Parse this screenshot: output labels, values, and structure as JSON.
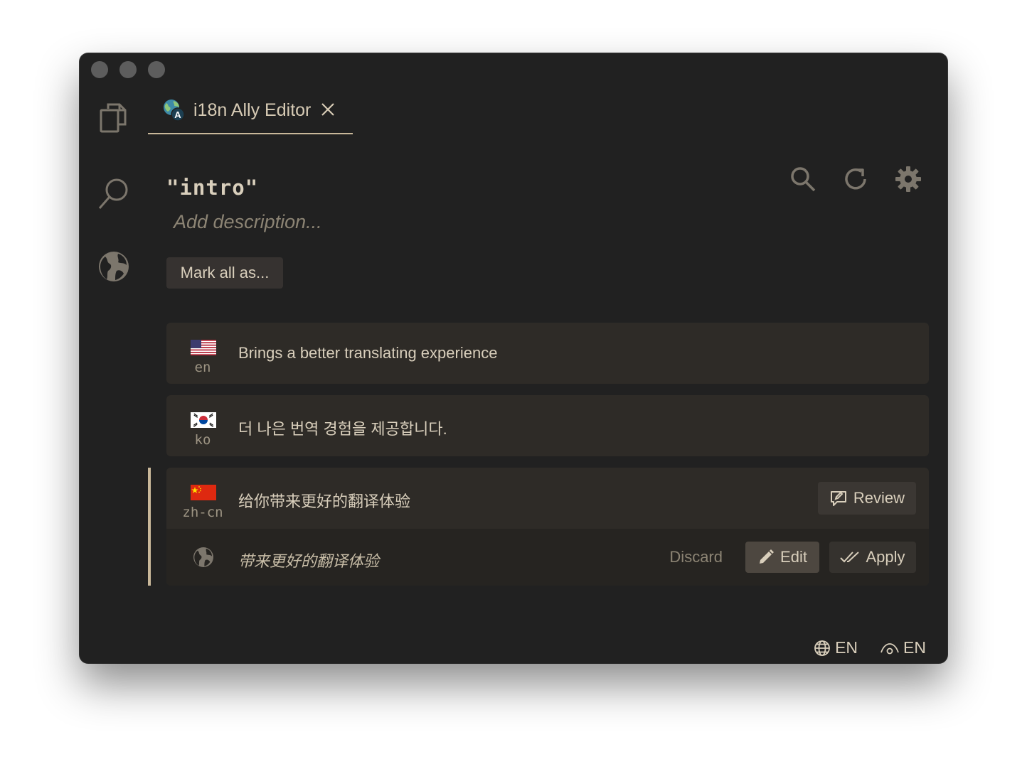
{
  "tab": {
    "title": "i18n Ally Editor",
    "logo_icon": "i18n-ally-logo",
    "close_icon": "close-icon"
  },
  "activity_bar": {
    "items": [
      {
        "icon": "explorer-icon"
      },
      {
        "icon": "search-icon"
      },
      {
        "icon": "globe-icon"
      }
    ]
  },
  "editor": {
    "key": "\"intro\"",
    "description_placeholder": "Add description...",
    "mark_all_label": "Mark all as...",
    "actions": [
      "search-icon",
      "refresh-icon",
      "settings-icon"
    ]
  },
  "records": [
    {
      "locale": "en",
      "flag": "us-flag",
      "text": "Brings a better translating experience"
    },
    {
      "locale": "ko",
      "flag": "kr-flag",
      "text": "더 나은 번역 경험을 제공합니다."
    },
    {
      "locale": "zh-cn",
      "flag": "cn-flag",
      "text": "给你带来更好的翻译体验",
      "review_label": "Review",
      "suggestion": {
        "text": "带来更好的翻译体验",
        "discard_label": "Discard",
        "edit_label": "Edit",
        "apply_label": "Apply"
      }
    }
  ],
  "statusbar": {
    "display_locale": "EN",
    "source_locale": "EN"
  },
  "colors": {
    "background": "#212121",
    "card": "#2e2b27",
    "accent": "#c9b89a",
    "text": "#d9cfbc",
    "muted": "#8c8474"
  }
}
